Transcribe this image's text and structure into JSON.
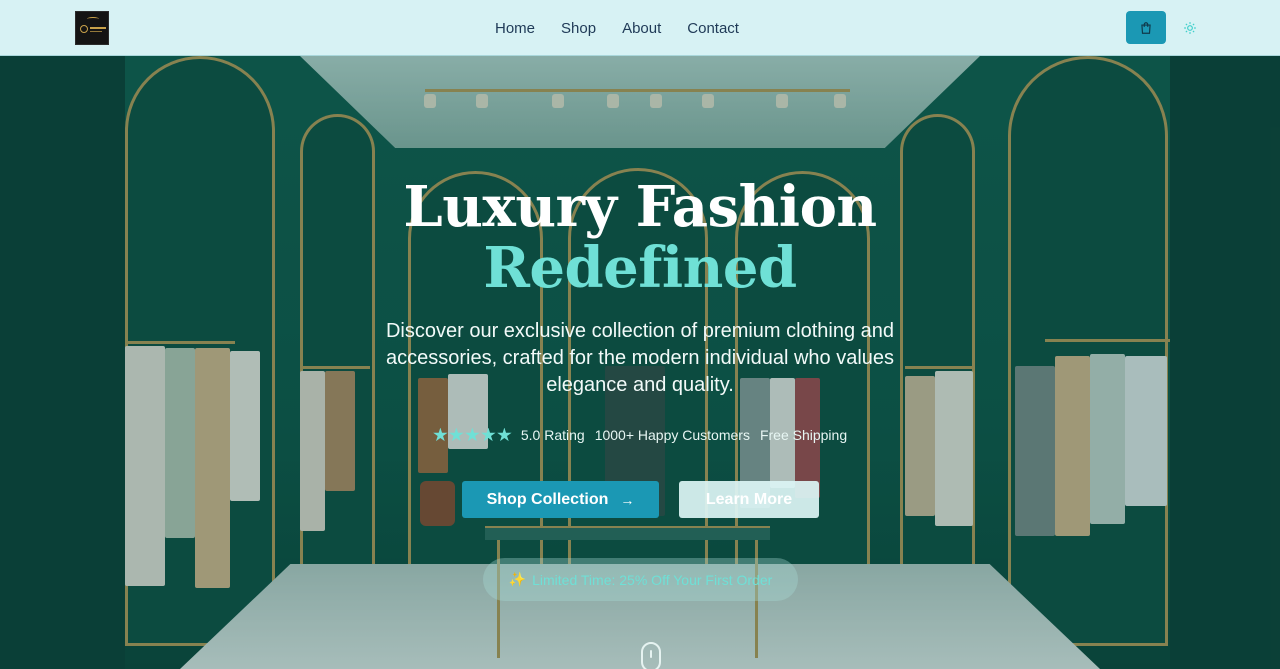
{
  "nav": {
    "logo_icon": "store-logo-icon",
    "links": [
      {
        "label": "Home"
      },
      {
        "label": "Shop"
      },
      {
        "label": "About"
      },
      {
        "label": "Contact"
      }
    ],
    "cart_icon": "shopping-bag-icon",
    "theme_icon": "sun-icon"
  },
  "hero": {
    "title_line1": "Luxury Fashion",
    "title_line2": "Redefined",
    "description": "Discover our exclusive collection of premium clothing and accessories, crafted for the modern individual who values elegance and quality.",
    "rating": {
      "stars": 5,
      "label": "5.0 Rating"
    },
    "customers": "1000+ Happy Customers",
    "shipping": "Free Shipping",
    "primary_button": "Shop Collection",
    "secondary_button": "Learn More",
    "promo_text": "Limited Time: 25% Off Your First Order"
  },
  "colors": {
    "nav_bg": "#d7f2f4",
    "accent": "#1b98b4",
    "highlight": "#6fe0d6"
  }
}
